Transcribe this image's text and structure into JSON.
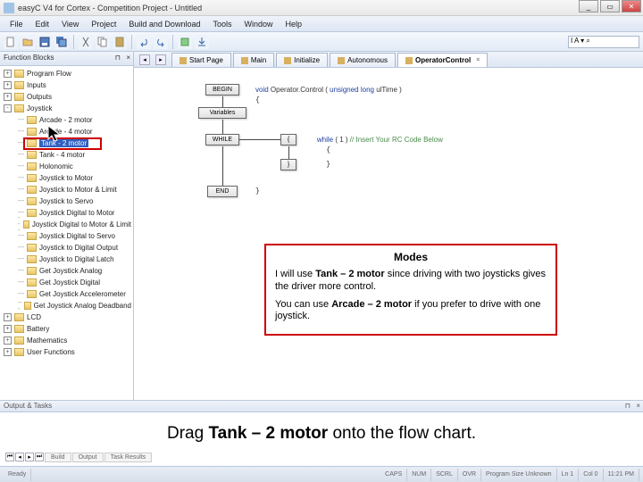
{
  "window": {
    "title": "easyC V4 for Cortex - Competition Project - Untitled",
    "min": "_",
    "max": "▭",
    "close": "✕"
  },
  "menu": [
    "File",
    "Edit",
    "View",
    "Project",
    "Build and Download",
    "Tools",
    "Window",
    "Help"
  ],
  "search_placeholder": "I A  ▾ ⌕",
  "panels": {
    "blocks": "Function Blocks",
    "output": "Output & Tasks"
  },
  "tree": {
    "root": [
      {
        "label": "Program Flow",
        "exp": "+"
      },
      {
        "label": "Inputs",
        "exp": "+"
      },
      {
        "label": "Outputs",
        "exp": "+"
      },
      {
        "label": "Joystick",
        "exp": "-"
      }
    ],
    "joystick": [
      "Arcade - 2 motor",
      "Arcade - 4 motor",
      "Tank - 2 motor",
      "Tank - 4 motor",
      "Holonomic",
      "Joystick to Motor",
      "Joystick to Motor & Limit",
      "Joystick to Servo",
      "Joystick Digital to Motor",
      "Joystick Digital to Motor & Limit",
      "Joystick Digital to Servo",
      "Joystick to Digital Output",
      "Joystick to Digital Latch",
      "Get Joystick Analog",
      "Get Joystick Digital",
      "Get Joystick Accelerometer",
      "Get Joystick Analog Deadband"
    ],
    "tail": [
      {
        "label": "LCD",
        "exp": "+"
      },
      {
        "label": "Battery",
        "exp": "+"
      },
      {
        "label": "Mathematics",
        "exp": "+"
      },
      {
        "label": "User Functions",
        "exp": "+"
      }
    ]
  },
  "tabs": {
    "items": [
      "Start Page",
      "Main",
      "Initialize",
      "Autonomous",
      "OperatorControl"
    ],
    "active": 4
  },
  "flow": {
    "begin": "BEGIN",
    "vars": "Variables",
    "while": "WHILE",
    "end": "END",
    "brace_open": "{",
    "brace_close": "}"
  },
  "code": {
    "l1a": "void ",
    "l1b": "Operator.Control ( ",
    "l1c": "unsigned long ",
    "l1d": "ulTime )",
    "l2": "{",
    "l3a": "    while ",
    "l3b": "( 1 ) ",
    "l3c": "// Insert Your RC Code Below",
    "l4": "    {",
    "l5": "    }",
    "l6": "}"
  },
  "annot": {
    "title": "Modes",
    "p1a": "I will use ",
    "p1b": "Tank – 2 motor",
    "p1c": " since driving with two joysticks gives the driver more control.",
    "p2a": "You can use ",
    "p2b": "Arcade – 2 motor",
    "p2c": " if you prefer to drive with one joystick."
  },
  "instruction": {
    "a": "Drag ",
    "b": "Tank – 2 motor",
    "c": " onto the flow chart."
  },
  "btmtabs": [
    "Build",
    "Output",
    "Task Results"
  ],
  "status": {
    "ready": "Ready",
    "caps": "CAPS",
    "num": "NUM",
    "scrl": "SCRL",
    "ovr": "OVR",
    "prog": "Program Size Unknown",
    "line": "Ln 1",
    "col": "Col 0",
    "time": "11:21 PM"
  }
}
